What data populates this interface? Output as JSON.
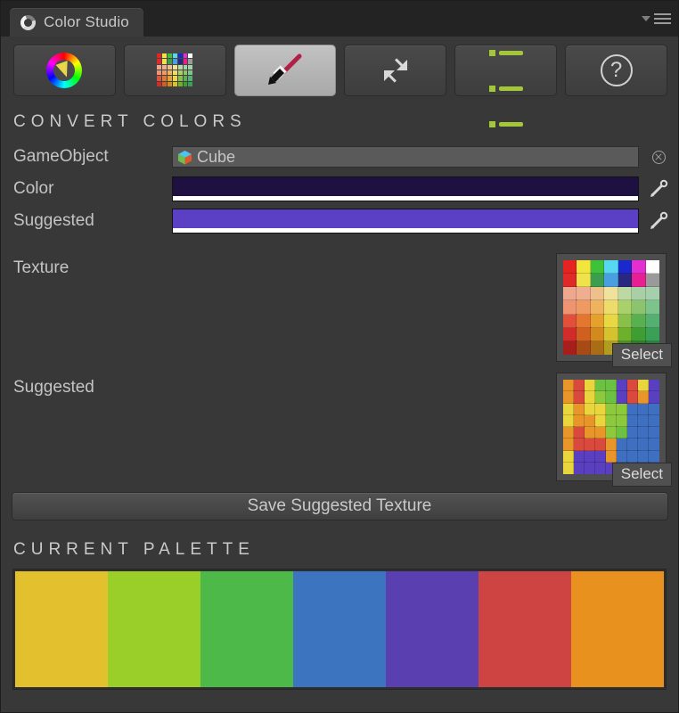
{
  "window": {
    "tab_title": "Color Studio",
    "logo_icon": "unity-logo-icon",
    "menu_caret_icon": "chevron-down-icon",
    "menu_icon": "hamburger-menu-icon"
  },
  "toolbar": {
    "buttons": [
      {
        "name": "color-wheel-tab",
        "icon": "color-wheel-icon",
        "active": false
      },
      {
        "name": "palette-grid-tab",
        "icon": "palette-grid-icon",
        "active": false
      },
      {
        "name": "brush-tab",
        "icon": "paint-brush-icon",
        "active": true
      },
      {
        "name": "shrink-tab",
        "icon": "shrink-arrows-icon",
        "active": false
      },
      {
        "name": "list-tab",
        "icon": "list-icon",
        "active": false
      },
      {
        "name": "help-tab",
        "icon": "question-mark-icon",
        "active": false
      }
    ],
    "help_glyph": "?"
  },
  "convert": {
    "heading": "CONVERT COLORS",
    "gameobject": {
      "label": "GameObject",
      "value": "Cube",
      "icon": "cube-icon",
      "clear_icon": "clear-circle-icon"
    },
    "color": {
      "label": "Color",
      "value": "#1E1040",
      "alpha_color": "#FFFFFF",
      "picker_icon": "eyedropper-icon"
    },
    "suggested_color": {
      "label": "Suggested",
      "value": "#5B3FC4",
      "alpha_color": "#FFFFFF",
      "picker_icon": "eyedropper-icon"
    },
    "texture": {
      "label": "Texture",
      "select_label": "Select",
      "swatches": [
        "#e52421",
        "#f2e63c",
        "#3ec23a",
        "#57d8f0",
        "#1a28cc",
        "#e32fd0",
        "#ffffff",
        "#e02a28",
        "#f0e24a",
        "#3a9e4e",
        "#4a9fe0",
        "#27287e",
        "#e81f92",
        "#9a9a9a",
        "#efa790",
        "#eeae8f",
        "#eec08c",
        "#eee29c",
        "#bcd9a4",
        "#a8cfa6",
        "#a6cfae",
        "#ee9470",
        "#ef9a63",
        "#efb35e",
        "#eedc6a",
        "#aad06a",
        "#8cc46e",
        "#7cc48c",
        "#e2503c",
        "#e4762f",
        "#e6a02c",
        "#e8d844",
        "#88c04a",
        "#58b050",
        "#54b070",
        "#cf2c2a",
        "#d06020",
        "#d28a1e",
        "#d4c22e",
        "#6cb02c",
        "#3e9e34",
        "#3aa058",
        "#a81e1c",
        "#a84a16",
        "#aa6c14",
        "#b09c1e",
        "#4c8e1c",
        "#2a7e24",
        "#28803c"
      ]
    },
    "suggested_texture": {
      "label": "Suggested",
      "select_label": "Select",
      "swatches": [
        "#e8962a",
        "#d94a3c",
        "#e8d63c",
        "#6cc142",
        "#6cc142",
        "#5a3fc0",
        "#d94a3c",
        "#e8d63c",
        "#5a3fc0",
        "#e8962a",
        "#d94a3c",
        "#e8d63c",
        "#8cc93c",
        "#6cc142",
        "#5a3fc0",
        "#d94a3c",
        "#e8962a",
        "#5a3fc0",
        "#e8d63c",
        "#e8962a",
        "#e8d63c",
        "#e8d63c",
        "#8cc93c",
        "#8cc93c",
        "#3f6fc0",
        "#3f6fc0",
        "#3f6fc0",
        "#e8d63c",
        "#e8962a",
        "#e8962a",
        "#e8d63c",
        "#8cc93c",
        "#8cc93c",
        "#3f6fc0",
        "#3f6fc0",
        "#3f6fc0",
        "#e8962a",
        "#d94a3c",
        "#e8962a",
        "#e8962a",
        "#8cc93c",
        "#6cc142",
        "#3f6fc0",
        "#3f6fc0",
        "#3f6fc0",
        "#e8962a",
        "#d94a3c",
        "#d94a3c",
        "#d94a3c",
        "#e8962a",
        "#3f6fc0",
        "#3f6fc0",
        "#3f6fc0",
        "#3f6fc0",
        "#e8d63c",
        "#5a3fc0",
        "#5a3fc0",
        "#5a3fc0",
        "#e8962a",
        "#3f6fc0",
        "#3f6fc0",
        "#3f6fc0",
        "#3f6fc0",
        "#e8d63c",
        "#5a3fc0",
        "#5a3fc0",
        "#5a3fc0",
        "#5a3fc0",
        "#3f6fc0",
        "#3f6fc0",
        "#3f6fc0",
        "#3f6fc0"
      ]
    },
    "save_button": "Save Suggested Texture"
  },
  "palette": {
    "heading": "CURRENT PALETTE",
    "colors": [
      "#e2c02e",
      "#9ace28",
      "#4cb949",
      "#3c74bf",
      "#5a3fb0",
      "#ce4442",
      "#e8911f"
    ]
  }
}
